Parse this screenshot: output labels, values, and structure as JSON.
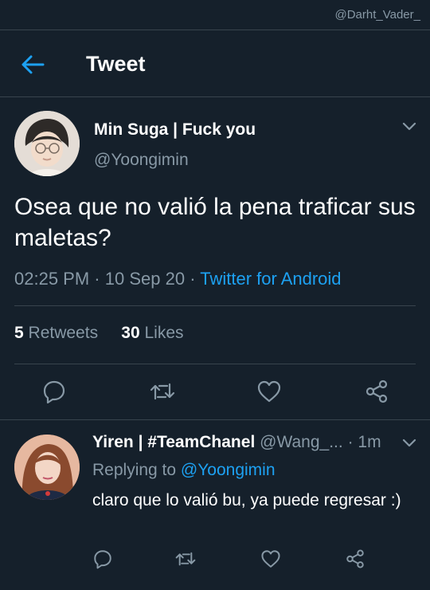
{
  "watermark": "@Darht_Vader_",
  "header": {
    "title": "Tweet"
  },
  "tweet": {
    "author_name": "Min Suga | Fuck you",
    "author_handle": "@Yoongimin",
    "text": "Osea que no valió la pena traficar sus maletas?",
    "time": "02:25 PM",
    "date": "10 Sep 20",
    "source": "Twitter for Android",
    "retweets_count": "5",
    "retweets_label": "Retweets",
    "likes_count": "30",
    "likes_label": "Likes"
  },
  "reply": {
    "author_name": "Yiren | #TeamChanel",
    "author_handle": "@Wang_...",
    "time": "1m",
    "replying_prefix": "Replying to",
    "replying_to": "@Yoongimin",
    "text": "claro que lo valió bu, ya puede regresar :)"
  },
  "icons": {
    "back": "arrow-left-icon",
    "more": "chevron-down-icon",
    "reply": "comment-icon",
    "retweet": "retweet-icon",
    "like": "heart-icon",
    "share": "share-icon"
  },
  "colors": {
    "background": "#15202b",
    "accent": "#1da1f2",
    "muted": "#8899a6",
    "divider": "#38444d"
  }
}
